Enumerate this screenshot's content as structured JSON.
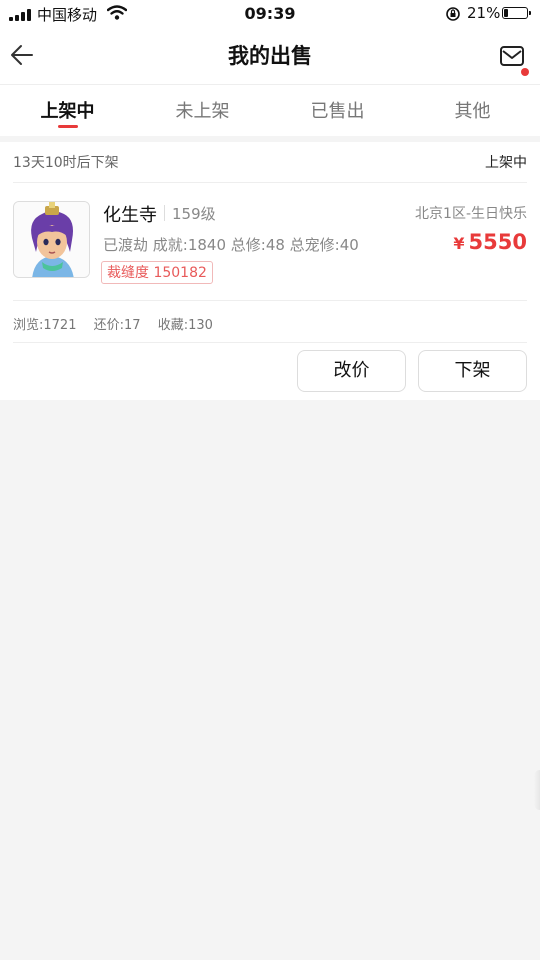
{
  "status_bar": {
    "carrier": "中国移动",
    "time": "09:39",
    "battery_percent": "21%",
    "battery_level": 0.21
  },
  "header": {
    "title": "我的出售",
    "has_notification": true
  },
  "tabs": [
    {
      "label": "上架中",
      "active": true
    },
    {
      "label": "未上架",
      "active": false
    },
    {
      "label": "已售出",
      "active": false
    },
    {
      "label": "其他",
      "active": false
    }
  ],
  "listing": {
    "countdown": "13天10时后下架",
    "status": "上架中",
    "name": "化生寺",
    "level": "159级",
    "server": "北京1区-生日快乐",
    "stats": "已渡劫 成就:1840 总修:48 总宠修:40",
    "price_symbol": "¥",
    "price": "5550",
    "tag": "裁缝度 150182",
    "views": "浏览:1721",
    "bargains": "还价:17",
    "favorites": "收藏:130",
    "actions": {
      "change_price": "改价",
      "delist": "下架"
    }
  },
  "colors": {
    "accent": "#e83a3a",
    "background": "#f4f4f4"
  }
}
